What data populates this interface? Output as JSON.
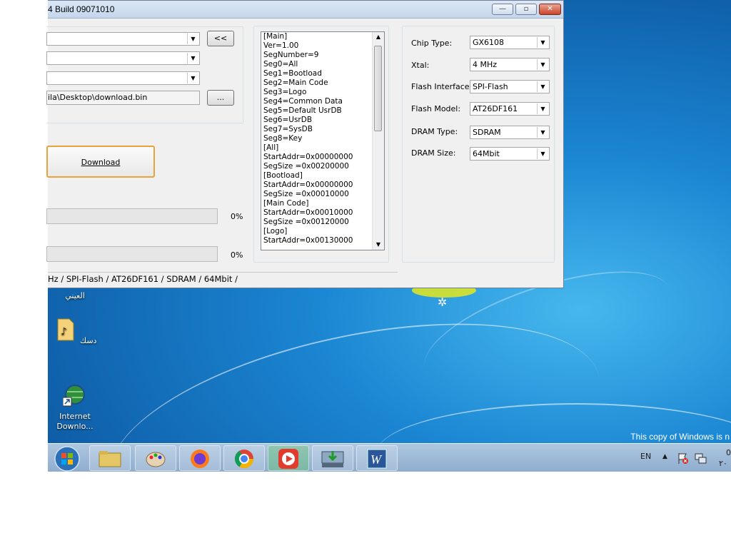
{
  "window": {
    "title": "4 Build 09071010",
    "controls": {
      "minimize": "—",
      "restore": "▫",
      "close": "✕"
    }
  },
  "left_panel": {
    "back_button": "<<",
    "file_path": "ila\\Desktop\\download.bin",
    "browse_button": "...",
    "download_button": "Download",
    "progress": [
      {
        "value": 0,
        "label": "0%"
      },
      {
        "value": 0,
        "label": "0%"
      }
    ]
  },
  "listbox_lines": [
    "[Main]",
    "Ver=1.00",
    "SegNumber=9",
    "Seg0=All",
    "Seg1=Bootload",
    "Seg2=Main Code",
    "Seg3=Logo",
    "Seg4=Common Data",
    "Seg5=Default UsrDB",
    "Seg6=UsrDB",
    "Seg7=SysDB",
    "Seg8=Key",
    "[All]",
    "StartAddr=0x00000000",
    "SegSize   =0x00200000",
    "[Bootload]",
    "StartAddr=0x00000000",
    "SegSize   =0x00010000",
    "[Main Code]",
    "StartAddr=0x00010000",
    "SegSize   =0x00120000",
    "[Logo]",
    "StartAddr=0x00130000"
  ],
  "settings": {
    "chip_type": {
      "label": "Chip Type:",
      "value": "GX6108"
    },
    "xtal": {
      "label": "Xtal:",
      "value": "4 MHz"
    },
    "flash_interface": {
      "label": "Flash Interface:",
      "value": "SPI-Flash"
    },
    "flash_model": {
      "label": "Flash Model:",
      "value": "AT26DF161"
    },
    "dram_type": {
      "label": "DRAM Type:",
      "value": "SDRAM"
    },
    "dram_size": {
      "label": "DRAM Size:",
      "value": "64Mbit"
    }
  },
  "status_bar": "Hz / SPI-Flash / AT26DF161 / SDRAM / 64Mbit /",
  "desktop": {
    "icons": [
      "العيني",
      "دسك",
      "Internet Downlo..."
    ],
    "watermark": "This copy of Windows is n"
  },
  "taskbar": {
    "language": "EN",
    "clock_line1": "0",
    "clock_line2": "٢٠"
  },
  "colors": {
    "desktop": "#1b86d3",
    "taskbar": "#9fbad8",
    "download_border": "#e8a33c"
  }
}
